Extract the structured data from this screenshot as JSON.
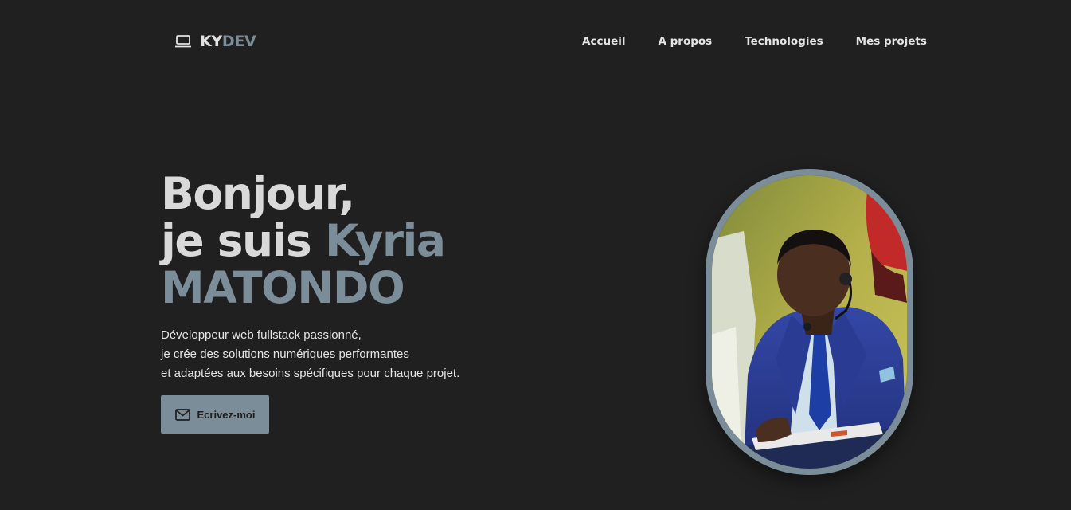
{
  "brand": {
    "part1": "KY",
    "part2": "DEV",
    "icon": "laptop-icon"
  },
  "nav": [
    {
      "label": "Accueil"
    },
    {
      "label": "A propos"
    },
    {
      "label": "Technologies"
    },
    {
      "label": "Mes projets"
    }
  ],
  "hero": {
    "greeting": "Bonjour,",
    "intro_prefix": "je suis ",
    "first_name": "Kyria",
    "last_name": "MATONDO",
    "description_lines": [
      "Développeur web fullstack passionné,",
      "je crée des solutions numériques performantes",
      "et adaptées aux besoins spécifiques pour chaque projet."
    ],
    "cta": {
      "label": "Ecrivez-moi",
      "icon": "mail-icon"
    }
  },
  "colors": {
    "background": "#202020",
    "accent": "#7b8d99",
    "text": "#d9d9d9"
  }
}
